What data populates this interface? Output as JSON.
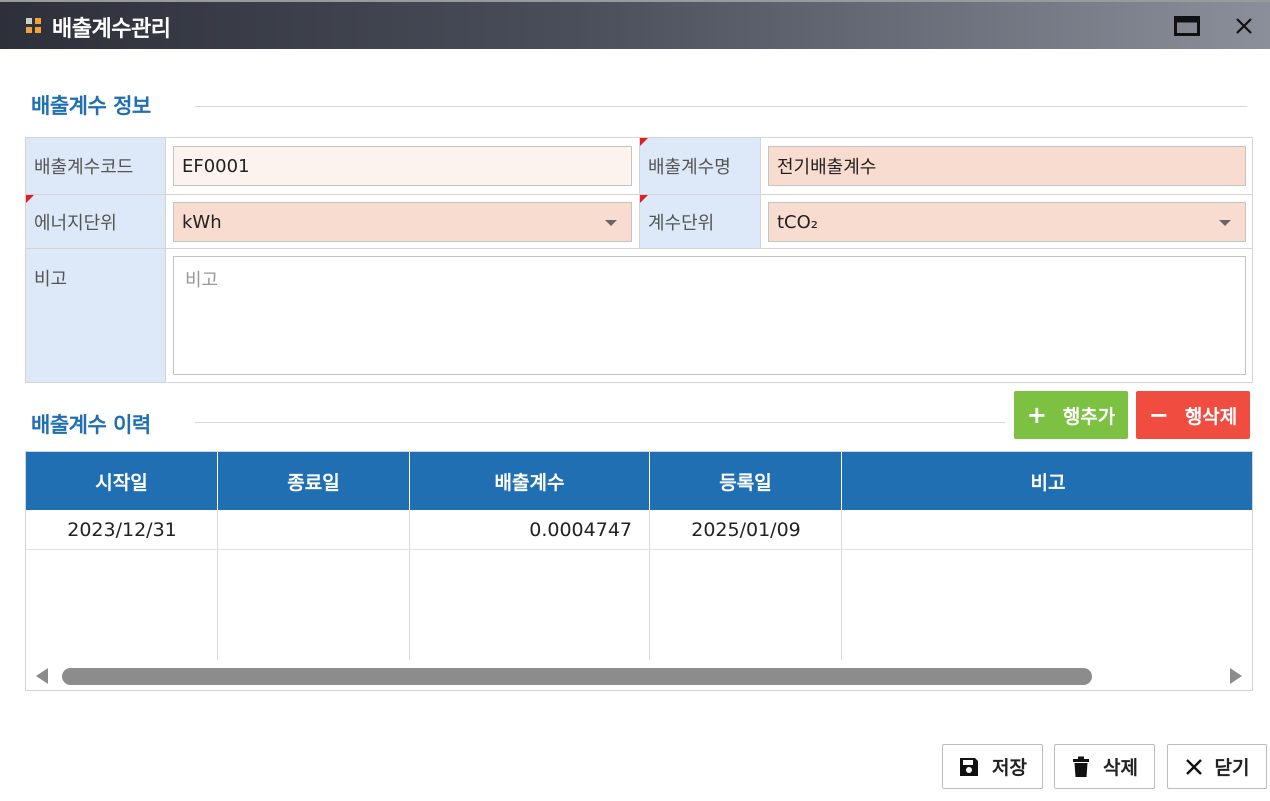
{
  "window": {
    "title": "배출계수관리",
    "colors": {
      "titlebar_start": "#2d3039",
      "titlebar_end": "#8a8f9a",
      "accent": "#1f6fb2",
      "logo_a": "#f2a23c",
      "logo_b": "#d0d0d0"
    }
  },
  "info_section": {
    "title": "배출계수 정보",
    "fields": {
      "code_label": "배출계수코드",
      "code_value": "EF0001",
      "name_label": "배출계수명",
      "name_value": "전기배출계수",
      "energy_unit_label": "에너지단위",
      "energy_unit_value": "kWh",
      "coef_unit_label": "계수단위",
      "coef_unit_value": "tCO₂",
      "note_label": "비고",
      "note_placeholder": "비고"
    }
  },
  "history_section": {
    "title": "배출계수 이력",
    "add_row_label": "행추가",
    "delete_row_label": "행삭제",
    "add_color": "#7cc142",
    "delete_color": "#f04c40",
    "columns": [
      "시작일",
      "종료일",
      "배출계수",
      "등록일",
      "비고"
    ],
    "rows": [
      {
        "start": "2023/12/31",
        "end": "",
        "coef": "0.0004747",
        "registered": "2025/01/09",
        "note": ""
      }
    ]
  },
  "footer": {
    "save_label": "저장",
    "delete_label": "삭제",
    "close_label": "닫기"
  }
}
